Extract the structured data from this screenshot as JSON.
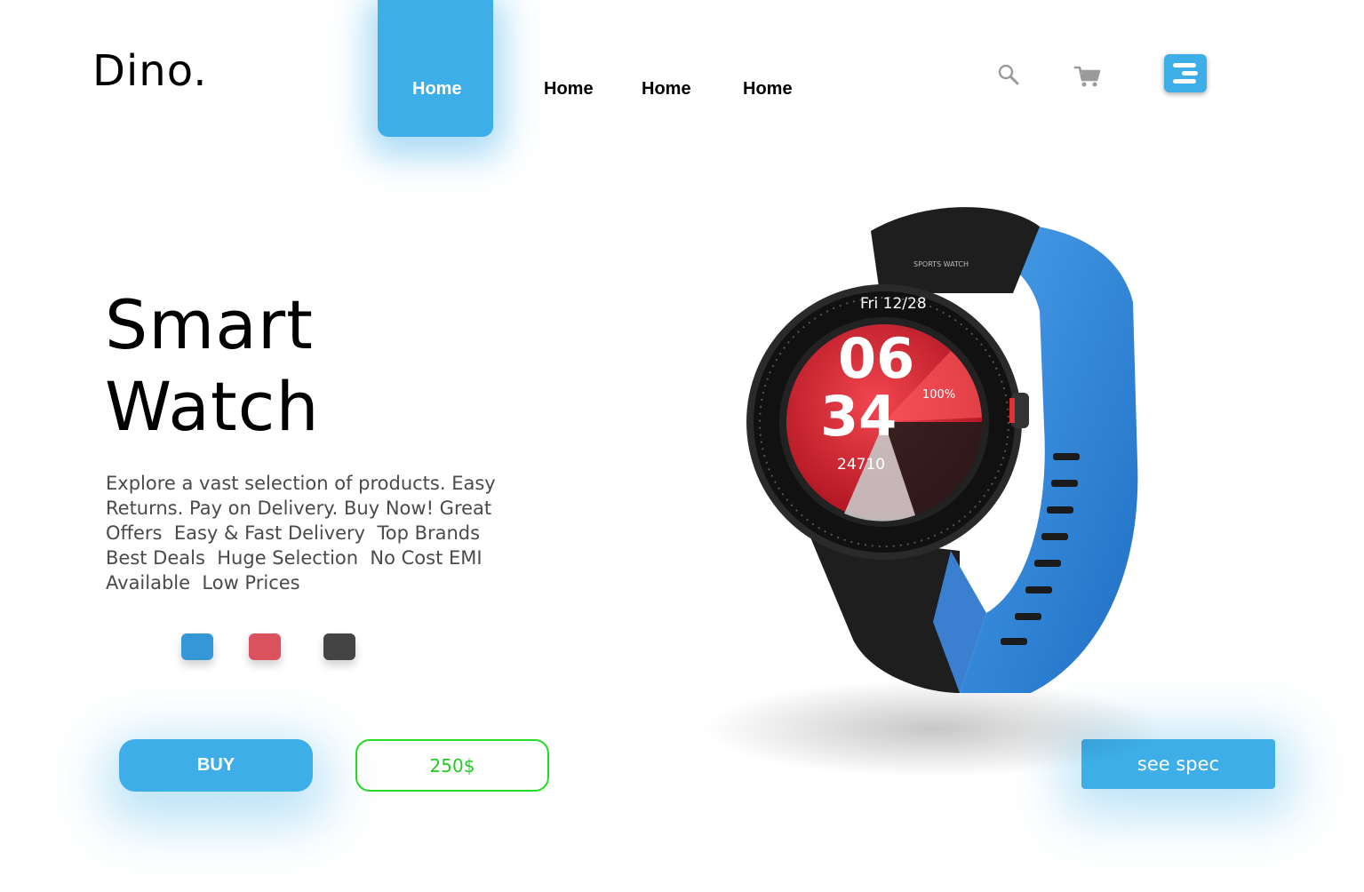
{
  "header": {
    "logo": "Dino.",
    "nav": [
      {
        "label": "Home",
        "active": true
      },
      {
        "label": "Home",
        "active": false
      },
      {
        "label": "Home",
        "active": false
      },
      {
        "label": "Home",
        "active": false
      }
    ],
    "icons": [
      "search-icon",
      "cart-icon",
      "menu-icon"
    ]
  },
  "hero": {
    "title_line1": "Smart",
    "title_line2": "Watch",
    "description": "Explore a vast selection of products. Easy Returns. Pay on Delivery. Buy Now! Great Offers  Easy & Fast Delivery  Top Brands  Best Deals  Huge Selection  No Cost EMI Available  Low Prices",
    "color_options": [
      {
        "name": "blue",
        "hex": "#3498d8"
      },
      {
        "name": "red",
        "hex": "#d9525e"
      },
      {
        "name": "dark-gray",
        "hex": "#444444"
      }
    ]
  },
  "actions": {
    "buy_label": "BUY",
    "price": "250$",
    "spec_label": "see spec"
  },
  "product_image": {
    "date": "Fri 12/28",
    "hour": "06",
    "minute": "34",
    "battery": "100%",
    "steps": "24710",
    "bezel_label": "SPORTS WATCH"
  },
  "colors": {
    "accent": "#3daee8",
    "price_border": "#22dd22"
  }
}
